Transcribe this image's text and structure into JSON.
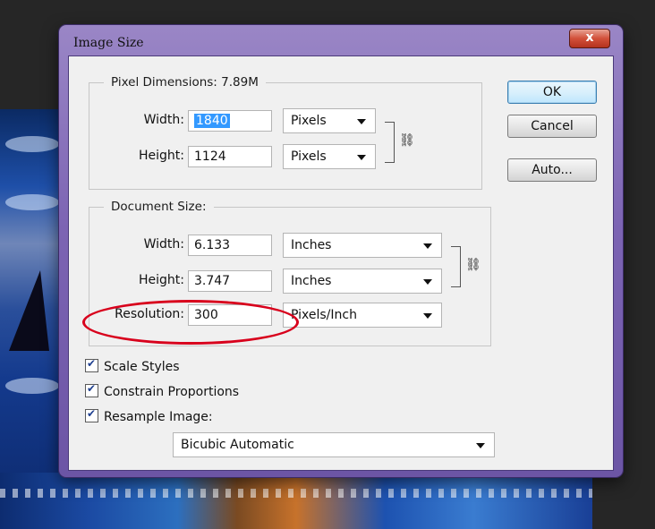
{
  "dialog": {
    "title": "Image Size",
    "close_label": "x"
  },
  "pixel_dimensions": {
    "title": "Pixel Dimensions:  7.89M",
    "width_label": "Width:",
    "width_value": "1840",
    "width_unit": "Pixels",
    "height_label": "Height:",
    "height_value": "1124",
    "height_unit": "Pixels"
  },
  "document_size": {
    "title": "Document Size:",
    "width_label": "Width:",
    "width_value": "6.133",
    "width_unit": "Inches",
    "height_label": "Height:",
    "height_value": "3.747",
    "height_unit": "Inches",
    "resolution_label": "Resolution:",
    "resolution_value": "300",
    "resolution_unit": "Pixels/Inch"
  },
  "buttons": {
    "ok": "OK",
    "cancel": "Cancel",
    "auto": "Auto..."
  },
  "options": {
    "scale_styles": "Scale Styles",
    "constrain_proportions": "Constrain Proportions",
    "resample_image": "Resample Image:",
    "resample_method": "Bicubic Automatic"
  },
  "colors": {
    "titlebar": "#7c64b3",
    "highlight": "#d8001c",
    "selection": "#3399ff"
  }
}
